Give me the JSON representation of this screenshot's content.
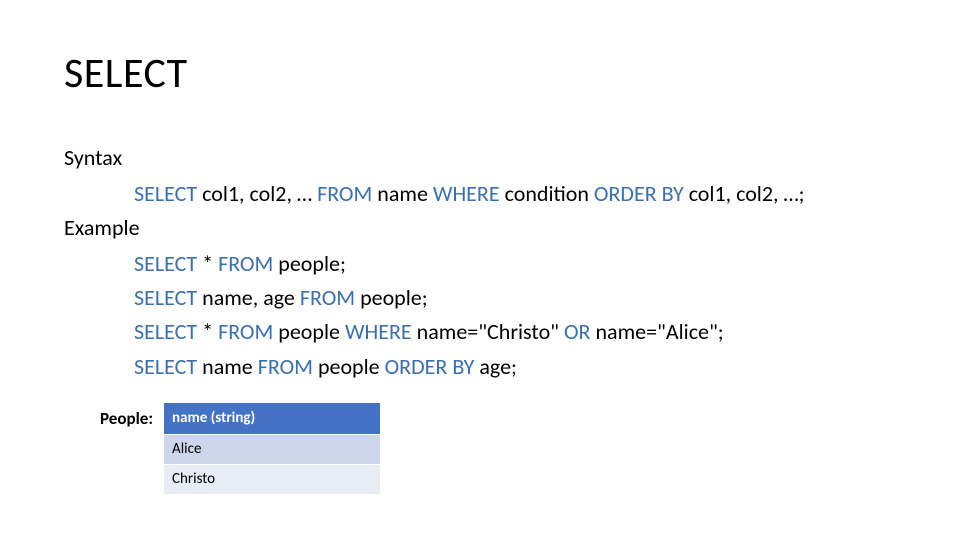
{
  "title": "SELECT",
  "syntax": {
    "label": "Syntax",
    "kw_select": "SELECT",
    "cols": "col1, col2, …",
    "kw_from": "FROM",
    "name": "name",
    "kw_where": "WHERE",
    "cond": "condition",
    "kw_order": "ORDER BY",
    "ordercols": "col1, col2, …;"
  },
  "example": {
    "label": "Example",
    "ex1": {
      "kw_select": "SELECT",
      "star": "*",
      "kw_from": "FROM",
      "tbl": "people;"
    },
    "ex2": {
      "kw_select": "SELECT",
      "cols": "name, age",
      "kw_from": "FROM",
      "tbl": "people;"
    },
    "ex3": {
      "kw_select": "SELECT",
      "star": "*",
      "kw_from": "FROM",
      "tbl": "people",
      "kw_where": "WHERE",
      "clause1": "name=\"Christo\"",
      "kw_or": "OR",
      "clause2": "name=\"Alice\";"
    },
    "ex4": {
      "kw_select": "SELECT",
      "cols": "name",
      "kw_from": "FROM",
      "tbl": "people",
      "kw_order": "ORDER BY",
      "ordercol": "age;"
    }
  },
  "table": {
    "label": "People:",
    "header": "name (string)",
    "rows": [
      "Alice",
      "Christo"
    ]
  }
}
